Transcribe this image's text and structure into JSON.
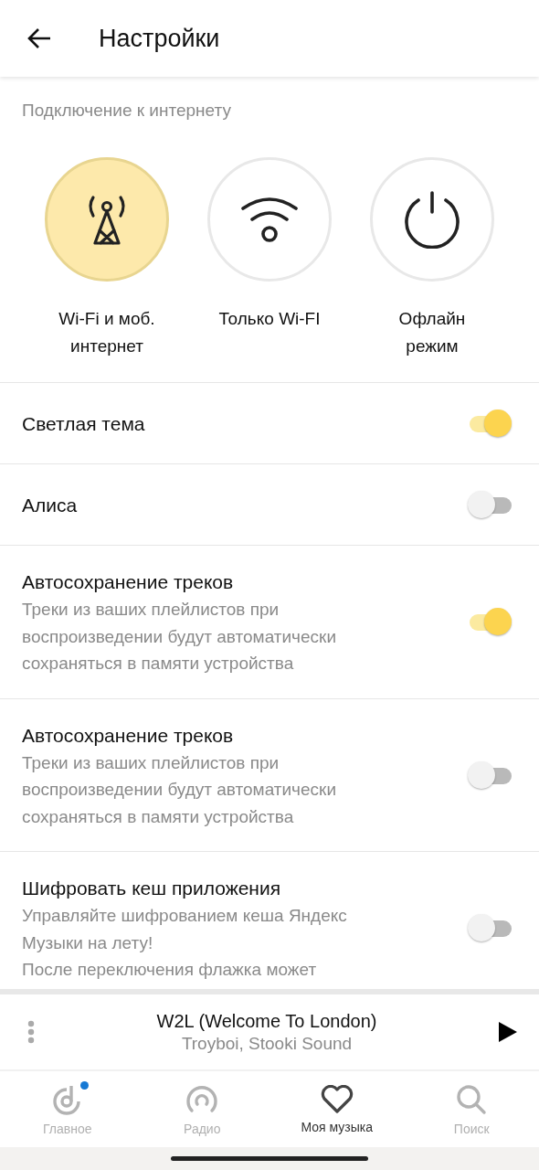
{
  "header": {
    "title": "Настройки"
  },
  "connection": {
    "label": "Подключение к интернету",
    "options": [
      {
        "kind": "mobile",
        "label": "Wi-Fi и моб. интернет",
        "selected": true
      },
      {
        "kind": "wifi",
        "label": "Только Wi-FI",
        "selected": false
      },
      {
        "kind": "offline",
        "label": "Офлайн режим",
        "selected": false
      }
    ]
  },
  "settings": [
    {
      "title": "Светлая тема",
      "on": true
    },
    {
      "title": "Алиса",
      "on": false
    },
    {
      "title": "Автосохранение треков",
      "description": [
        "Треки из ваших плейлистов при воспроизведении будут автоматически сохраняться в памяти устройства"
      ],
      "on": true
    },
    {
      "title": "Автосохранение треков",
      "description": [
        "Треки из ваших плейлистов при воспроизведении будут автоматически сохраняться в памяти устройства"
      ],
      "on": false
    },
    {
      "title": "Шифровать кеш приложения",
      "description": [
        "Управляйте шифрованием кеша Яндекс Музыки на лету!",
        "После переключения флажка может"
      ],
      "on": false
    }
  ],
  "player": {
    "title": "W2L (Welcome To London)",
    "artist": "Troyboi, Stooki Sound"
  },
  "nav": [
    {
      "kind": "home",
      "label": "Главное",
      "selected": false,
      "dot": true
    },
    {
      "kind": "radio",
      "label": "Радио",
      "selected": false,
      "dot": false
    },
    {
      "kind": "music",
      "label": "Моя музыка",
      "selected": true,
      "dot": false
    },
    {
      "kind": "search",
      "label": "Поиск",
      "selected": false,
      "dot": false
    }
  ]
}
